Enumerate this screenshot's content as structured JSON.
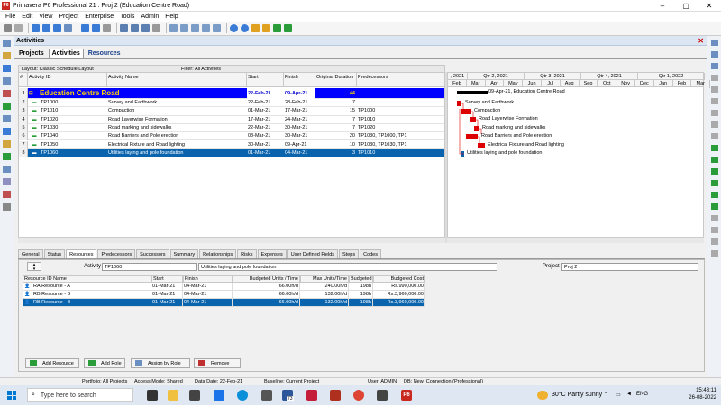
{
  "window": {
    "title": "Primavera P6 Professional 21 : Proj 2 (Education Centre Road)",
    "logo": "P6"
  },
  "menu": [
    "File",
    "Edit",
    "View",
    "Project",
    "Enterprise",
    "Tools",
    "Admin",
    "Help"
  ],
  "header": {
    "title": "Activities"
  },
  "tabs": [
    "Projects",
    "Activities",
    "Resources"
  ],
  "layout": {
    "label": "Layout: Classic Schedule Layout",
    "filter": "Filter: All Activities"
  },
  "columns": [
    "#",
    "Activity ID",
    "Activity Name",
    "Start",
    "Finish",
    "Original Duration",
    "Predecessors"
  ],
  "project_row": {
    "num": "1",
    "name": "Education Centre Road",
    "start": "22-Feb-21",
    "finish": "09-Apr-21",
    "dur": "44"
  },
  "rows": [
    {
      "num": "2",
      "id": "TP1000",
      "name": "Survey and Earthwork",
      "start": "22-Feb-21",
      "finish": "28-Feb-21",
      "dur": "7",
      "pred": ""
    },
    {
      "num": "3",
      "id": "TP1010",
      "name": "Compaction",
      "start": "01-Mar-21",
      "finish": "17-Mar-21",
      "dur": "15",
      "pred": "TP1000"
    },
    {
      "num": "4",
      "id": "TP1020",
      "name": "Road Layerwise Formation",
      "start": "17-Mar-21",
      "finish": "24-Mar-21",
      "dur": "7",
      "pred": "TP1010"
    },
    {
      "num": "5",
      "id": "TP1030",
      "name": "Road marking and sidewalks",
      "start": "22-Mar-21",
      "finish": "30-Mar-21",
      "dur": "7",
      "pred": "TP1020"
    },
    {
      "num": "6",
      "id": "TP1040",
      "name": "Road Barriers and Pole erection",
      "start": "08-Mar-21",
      "finish": "30-Mar-21",
      "dur": "20",
      "pred": "TP1030, TP1000, TP1"
    },
    {
      "num": "7",
      "id": "TP1050",
      "name": "Electrical Fixture and Road lighting",
      "start": "30-Mar-21",
      "finish": "09-Apr-21",
      "dur": "10",
      "pred": "TP1030, TP1030, TP1"
    },
    {
      "num": "8",
      "id": "TP1060",
      "name": "Utilities laying and pole foundation",
      "start": "01-Mar-21",
      "finish": "04-Mar-21",
      "dur": "3",
      "pred": "TP1010"
    }
  ],
  "gantt": {
    "quarters": [
      ", 2021",
      "Qtr 2, 2021",
      "Qtr 3, 2021",
      "Qtr 4, 2021",
      "Qtr 1, 2022"
    ],
    "months": [
      "Feb",
      "Mar",
      "Apr",
      "May",
      "Jun",
      "Jul",
      "Aug",
      "Sep",
      "Oct",
      "Nov",
      "Dec",
      "Jan",
      "Feb",
      "Mar"
    ],
    "labels": [
      "09-Apr-21, Education Centre Road",
      "Survey and Earthwork",
      "Compaction",
      "Road Layerwise Formation",
      "Road marking and sidewalks",
      "Road Barriers and Pole erection",
      "Electrical Fixture and Road lighting",
      "Utilities laying and pole foundation"
    ]
  },
  "bottom_tabs": [
    "General",
    "Status",
    "Resources",
    "Predecessors",
    "Successors",
    "Summary",
    "Relationships",
    "Risks",
    "Expenses",
    "User Defined Fields",
    "Steps",
    "Codes"
  ],
  "detail": {
    "activity_label": "Activity",
    "activity_id": "TP1060",
    "activity_name": "Utilities laying and pole foundation",
    "project_label": "Project",
    "project": "Proj 2"
  },
  "res_columns": [
    "Resource ID Name",
    "Start",
    "Finish",
    "Budgeted Units / Time",
    "Max Units/Time",
    "Budgeted Units",
    "Budgeted Cost"
  ],
  "resources": [
    {
      "name": "RA.Resource - A",
      "start": "01-Mar-21",
      "finish": "04-Mar-21",
      "but": "66.00h/d",
      "mut": "240.00h/d",
      "bu": "198h",
      "bc": "Rs.990,000.00"
    },
    {
      "name": "RB.Resource - B",
      "start": "01-Mar-21",
      "finish": "04-Mar-21",
      "but": "66.00h/d",
      "mut": "132.00h/d",
      "bu": "198h",
      "bc": "Rs.3,960,000.00"
    },
    {
      "name": "RB.Resource - B",
      "start": "01-Mar-21",
      "finish": "04-Mar-21",
      "but": "66.00h/d",
      "mut": "132.00h/d",
      "bu": "198h",
      "bc": "Rs.3,960,000.00"
    }
  ],
  "buttons": [
    "Add Resource",
    "Add Role",
    "Assign by Role",
    "Remove"
  ],
  "status": {
    "portfolio": "Portfolio: All Projects",
    "access": "Access Mode: Shared",
    "data_date": "Data Date: 22-Feb-21",
    "baseline": "Baseline: Current Project",
    "user": "User: ADMIN",
    "db": "DB: New_Connection (Professional)"
  },
  "taskbar": {
    "search": "Type here to search",
    "weather": "30°C  Partly sunny",
    "lang": "ENG",
    "time": "15:43:11",
    "date": "26-08-2022",
    "badge": "73"
  }
}
